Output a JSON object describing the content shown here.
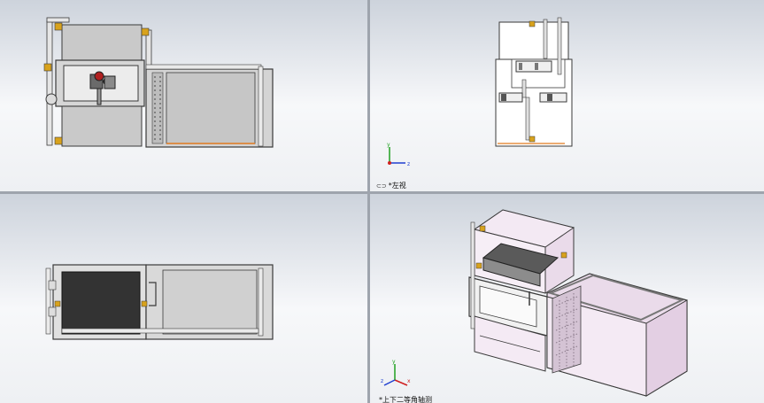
{
  "viewports": {
    "front": {
      "label": ""
    },
    "left": {
      "label": "*左视",
      "label_icon": "view-orientation-icon"
    },
    "top": {
      "label": ""
    },
    "iso": {
      "label": "*上下二等角轴测",
      "label_icon": "view-orientation-icon"
    }
  },
  "triad_axes": {
    "x": "x",
    "y": "y",
    "z": "z"
  },
  "colors": {
    "line": "#3a3a3a",
    "panel_grey": "#c9c9c9",
    "panel_dark": "#3b3b3b",
    "tank_pink": "#eadbea",
    "orange_edge": "#e07a1f",
    "valve_red": "#b02020",
    "fitting_yellow": "#d8a21c",
    "axis_x": "#d02020",
    "axis_y": "#20a020",
    "axis_z": "#2040d0"
  }
}
